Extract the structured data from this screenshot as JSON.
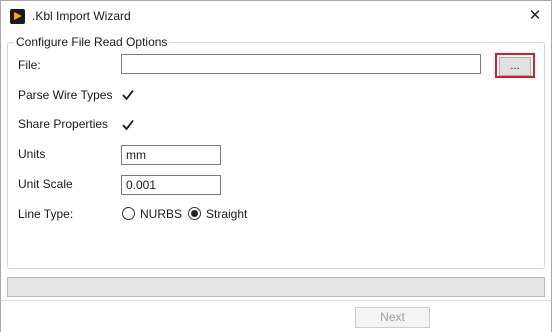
{
  "window": {
    "title": ".Kbl Import Wizard",
    "app_icon": "play-logo-icon",
    "close_glyph": "✕"
  },
  "group": {
    "title": "Configure File Read Options"
  },
  "file": {
    "label": "File:",
    "value": "",
    "browse_label": "..."
  },
  "parse_wire_types": {
    "label": "Parse Wire Types",
    "checked": true
  },
  "share_properties": {
    "label": "Share Properties",
    "checked": true
  },
  "units": {
    "label": "Units",
    "value": "mm"
  },
  "unit_scale": {
    "label": "Unit Scale",
    "value": "0.001"
  },
  "line_type": {
    "label": "Line Type:",
    "options": [
      "NURBS",
      "Straight"
    ],
    "selected": "Straight"
  },
  "progress": {
    "fraction": 0
  },
  "footer": {
    "next_label": "Next",
    "next_enabled": false
  },
  "colors": {
    "highlight": "#e01a23",
    "icon_accent": "#f5a800"
  }
}
